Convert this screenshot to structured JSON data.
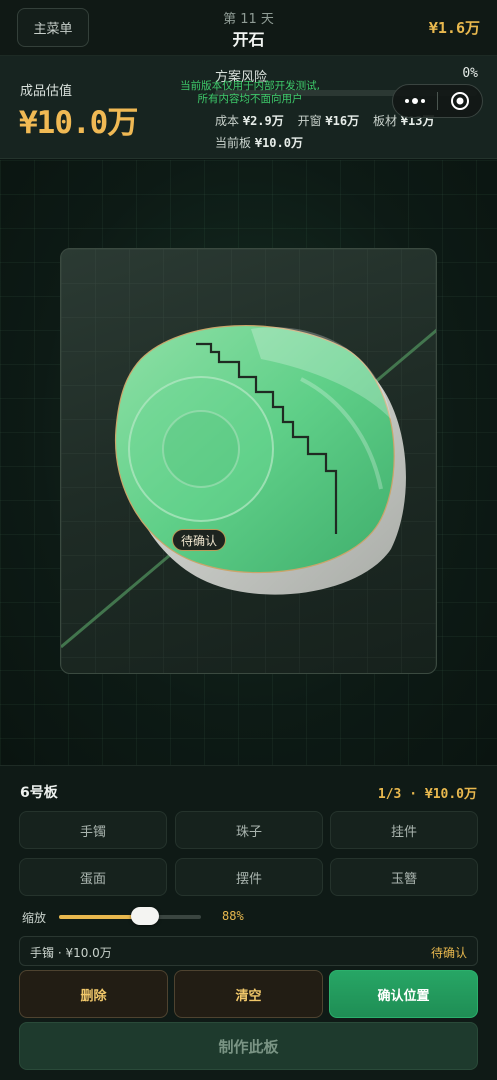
{
  "header": {
    "menu_label": "主菜单",
    "day_label": "第 11 天",
    "title": "开石",
    "cash": "¥1.6万"
  },
  "summary": {
    "estimate_label": "成品估值",
    "estimate_value": "¥10.0万",
    "risk_label": "方案风险",
    "risk_value": "0%",
    "risk_fraction": 0,
    "cost_label": "成本",
    "cost_value": "¥2.9万",
    "window_label": "开窗",
    "window_value": "¥16万",
    "slab_label": "板材",
    "slab_value": "¥13万",
    "current_label": "当前板",
    "current_value": "¥10.0万",
    "dev_notice_line1": "当前版本仅用于内部开发测试,",
    "dev_notice_line2": "所有内容均不面向用户"
  },
  "stage": {
    "marker_label": "待确认"
  },
  "panel": {
    "board_name": "6号板",
    "board_progress": "1/3 · ¥10.0万",
    "options": [
      "手镯",
      "珠子",
      "挂件",
      "蛋面",
      "摆件",
      "玉簪"
    ],
    "zoom_label": "缩放",
    "zoom_value": "88%",
    "zoom_fraction": 0.88,
    "status_item": "手镯 · ¥10.0万",
    "status_state": "待确认",
    "delete_label": "删除",
    "clear_label": "清空",
    "confirm_label": "确认位置",
    "make_label": "制作此板"
  },
  "colors": {
    "gold": "#e8b84e",
    "jade": "#5fcf88",
    "accent_green": "#27a665"
  }
}
